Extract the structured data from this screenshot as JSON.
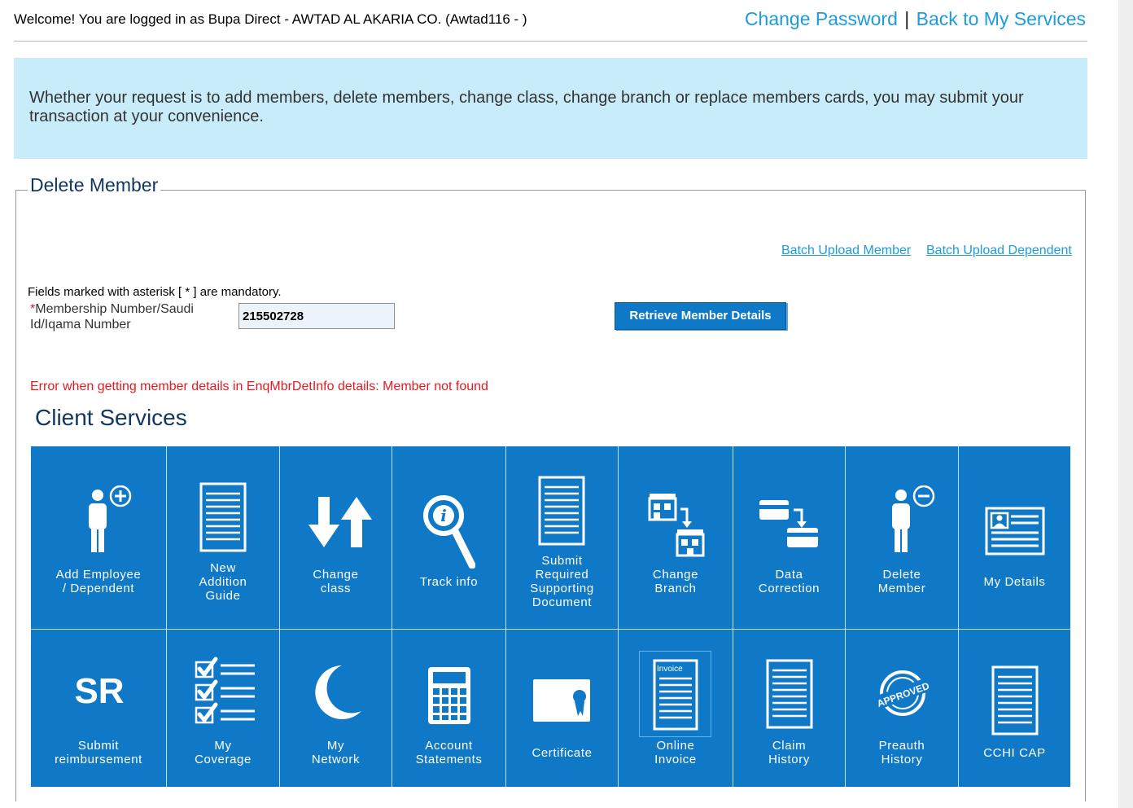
{
  "header": {
    "welcome": "Welcome! You are logged in as Bupa Direct - AWTAD AL AKARIA CO. (Awtad116 - )",
    "change_password": "Change Password",
    "separator": "|",
    "back_to_services": "Back to My Services"
  },
  "info": {
    "text": "Whether your request is to add members, delete members, change class, change branch or replace members cards, you may submit your transaction at your convenience."
  },
  "form": {
    "legend": "Delete Member",
    "batch_member": "Batch Upload Member",
    "batch_dependent": "Batch Upload Dependent",
    "mandatory_note": "Fields marked with asterisk [ * ] are mandatory.",
    "asterisk": "*",
    "field_label": "Membership Number/Saudi Id/Iqama Number",
    "field_value": "215502728",
    "retrieve_label": "Retrieve Member Details",
    "error": "Error when getting member details in EnqMbrDetInfo details: Member not found"
  },
  "client_services": {
    "title": "Client Services",
    "row1": [
      {
        "icon": "add-person-icon",
        "line1": "Add Employee",
        "line2": "/ Dependent",
        "line3": "",
        "line4": ""
      },
      {
        "icon": "document-icon",
        "line1": "New",
        "line2": "Addition",
        "line3": "Guide",
        "line4": ""
      },
      {
        "icon": "swap-arrows-icon",
        "line1": "Change",
        "line2": "class",
        "line3": "",
        "line4": ""
      },
      {
        "icon": "magnifier-info-icon",
        "line1": "Track info",
        "line2": "",
        "line3": "",
        "line4": ""
      },
      {
        "icon": "document-icon",
        "line1": "Submit",
        "line2": "Required",
        "line3": "Supporting",
        "line4": "Document"
      },
      {
        "icon": "branch-icon",
        "line1": "Change",
        "line2": "Branch",
        "line3": "",
        "line4": ""
      },
      {
        "icon": "cards-icon",
        "line1": "Data",
        "line2": "Correction",
        "line3": "",
        "line4": ""
      },
      {
        "icon": "remove-person-icon",
        "line1": "Delete",
        "line2": "Member",
        "line3": "",
        "line4": ""
      },
      {
        "icon": "id-card-icon",
        "line1": "My Details",
        "line2": "",
        "line3": "",
        "line4": ""
      }
    ],
    "row2": [
      {
        "icon": "sr-icon",
        "sr_text": "SR",
        "line1": "Submit",
        "line2": "reimbursement"
      },
      {
        "icon": "checklist-icon",
        "line1": "My",
        "line2": "Coverage"
      },
      {
        "icon": "crescent-icon",
        "line1": "My",
        "line2": "Network"
      },
      {
        "icon": "calculator-icon",
        "line1": "Account",
        "line2": "Statements"
      },
      {
        "icon": "certificate-icon",
        "line1": "Certificate",
        "line2": ""
      },
      {
        "icon": "invoice-icon",
        "invoice_text": "Invoice",
        "line1": "Online",
        "line2": "Invoice"
      },
      {
        "icon": "document-icon",
        "line1": "Claim",
        "line2": "History"
      },
      {
        "icon": "approved-stamp-icon",
        "stamp_text": "APPROVED",
        "line1": "Preauth",
        "line2": "History"
      },
      {
        "icon": "document-icon",
        "line1": "CCHI CAP",
        "line2": ""
      }
    ]
  }
}
